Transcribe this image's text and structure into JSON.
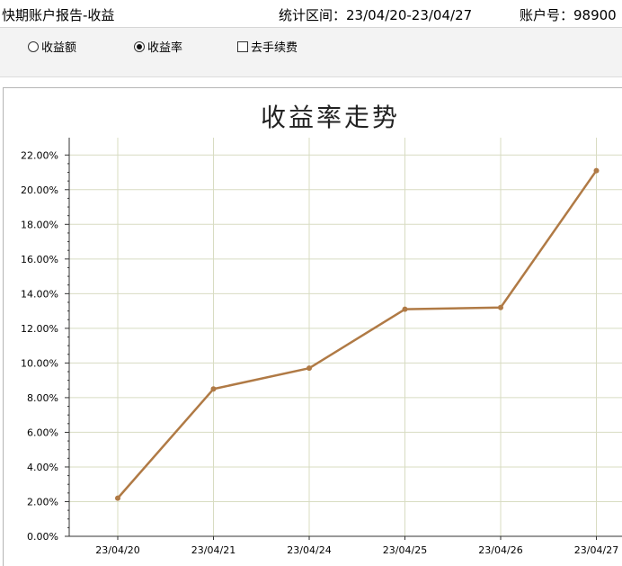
{
  "header": {
    "title": "快期账户报告-收益",
    "range": "统计区间：23/04/20-23/04/27",
    "account": "账户号：98900"
  },
  "options": {
    "profit_amount": "收益额",
    "profit_rate": "收益率",
    "exclude_fees": "去手续费",
    "selected": "profit_rate",
    "exclude_fees_checked": false
  },
  "chart_data": {
    "type": "line",
    "title": "收益率走势",
    "categories": [
      "23/04/20",
      "23/04/21",
      "23/04/24",
      "23/04/25",
      "23/04/26",
      "23/04/27"
    ],
    "series": [
      {
        "values": [
          2.2,
          8.5,
          9.7,
          13.1,
          13.2,
          21.1
        ],
        "color": "#b07a45"
      }
    ],
    "y_tick_labels": [
      "0.00%",
      "2.00%",
      "4.00%",
      "6.00%",
      "8.00%",
      "10.00%",
      "12.00%",
      "14.00%",
      "16.00%",
      "18.00%",
      "20.00%",
      "22.00%"
    ],
    "ylim": [
      0,
      23
    ],
    "grid": true,
    "grid_color": "#d8dcc2"
  }
}
